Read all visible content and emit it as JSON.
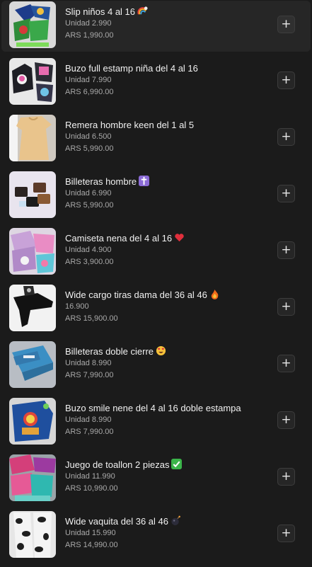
{
  "products": [
    {
      "name": "Slip niños 4 al 16",
      "emoji": "rainbow-icon",
      "unit": "Unidad 2.990",
      "price": "ARS 1,990.00",
      "add_label": "+"
    },
    {
      "name": "Buzo full estamp niña del 4 al 16",
      "emoji": "",
      "unit": "Unidad 7.990",
      "price": "ARS 6,990.00",
      "add_label": "+"
    },
    {
      "name": "Remera hombre keen del 1 al 5",
      "emoji": "",
      "unit": "Unidad 6.500",
      "price": "ARS 5,990.00",
      "add_label": "+"
    },
    {
      "name": "Billeteras hombre",
      "emoji": "latin-cross-icon",
      "unit": "Unidad 6.990",
      "price": "ARS 5,990.00",
      "add_label": "+"
    },
    {
      "name": "Camiseta nena del 4 al 16",
      "emoji": "red-heart-icon",
      "unit": "Unidad 4.900",
      "price": "ARS 3,900.00",
      "add_label": "+"
    },
    {
      "name": "Wide cargo tiras dama del 36 al 46",
      "emoji": "fire-icon",
      "unit": "16.900",
      "price": "ARS 15,900.00",
      "add_label": "+"
    },
    {
      "name": "Billeteras doble cierre",
      "emoji": "heart-eyes-icon",
      "unit": "Unidad 8.990",
      "price": "ARS 7,990.00",
      "add_label": "+"
    },
    {
      "name": "Buzo smile nene del 4 al 16 doble estampa",
      "emoji": "",
      "unit": "Unidad 8.990",
      "price": "ARS 7,990.00",
      "add_label": "+"
    },
    {
      "name": "Juego de toallon 2 piezas",
      "emoji": "check-mark-icon",
      "unit": "Unidad 11.990",
      "price": "ARS 10,990.00",
      "add_label": "+"
    },
    {
      "name": "Wide vaquita del 36 al 46",
      "emoji": "bomb-icon",
      "unit": "Unidad 15.990",
      "price": "ARS 14,990.00",
      "add_label": "+"
    }
  ],
  "colors": {
    "background": "#1b1b1b",
    "highlight_row": "#262626",
    "text_primary": "#f1f1f1",
    "text_secondary": "#a9a9a9"
  }
}
